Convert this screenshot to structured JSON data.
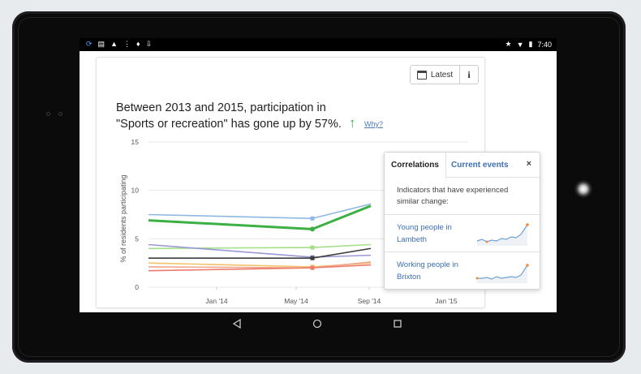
{
  "status_bar": {
    "left_icons": [
      "sync-icon",
      "image-icon",
      "android-icon",
      "menu-icon",
      "twitter-icon",
      "download-icon"
    ],
    "right_icons": [
      "star-icon",
      "wifi-icon",
      "battery-icon"
    ],
    "time": "7:40"
  },
  "toolbar": {
    "latest_label": "Latest",
    "info_label": "i"
  },
  "headline": {
    "line1": "Between 2013 and 2015, participation in",
    "line2": "\"Sports or recreation\" has gone up by 57%.",
    "why_link": "Why?"
  },
  "colors": {
    "accent_green": "#3cb043",
    "link_blue": "#3c6fb3"
  },
  "chart_data": {
    "type": "line",
    "ylabel": "% of residents participating",
    "ylim": [
      0,
      15
    ],
    "yticks": [
      "15",
      "10",
      "5",
      "0"
    ],
    "x_tick_labels": [
      "Jan '14",
      "May '14",
      "Sep '14",
      "Jan '15"
    ],
    "x": [
      "2013",
      "2014",
      "2015"
    ],
    "series": [
      {
        "color": "#3cb043",
        "values": [
          6.9,
          6.0,
          8.4
        ],
        "highlighted": true
      },
      {
        "color": "#8fb8e0",
        "values": [
          7.5,
          7.1,
          8.6
        ]
      },
      {
        "color": "#a4e08a",
        "values": [
          4.0,
          4.1,
          4.4
        ]
      },
      {
        "color": "#9b97d6",
        "values": [
          4.4,
          3.1,
          3.3
        ]
      },
      {
        "color": "#3d3d3d",
        "values": [
          3.0,
          3.0,
          4.0
        ]
      },
      {
        "color": "#f2c26b",
        "values": [
          2.5,
          2.1,
          2.5
        ]
      },
      {
        "color": "#f0a58c",
        "values": [
          2.1,
          2.0,
          2.6
        ]
      },
      {
        "color": "#ec7d6e",
        "values": [
          1.7,
          2.0,
          2.3
        ]
      }
    ]
  },
  "popover": {
    "tab_correlations": "Correlations",
    "tab_current_events": "Current events",
    "close_label": "×",
    "description": "Indicators that have experienced similar change:",
    "items": [
      {
        "label": "Young people in Lambeth"
      },
      {
        "label": "Working people in Brixton"
      }
    ]
  },
  "nav": {
    "back_icon": "back-triangle-icon",
    "home_icon": "home-circle-icon",
    "recents_icon": "recents-square-icon"
  }
}
